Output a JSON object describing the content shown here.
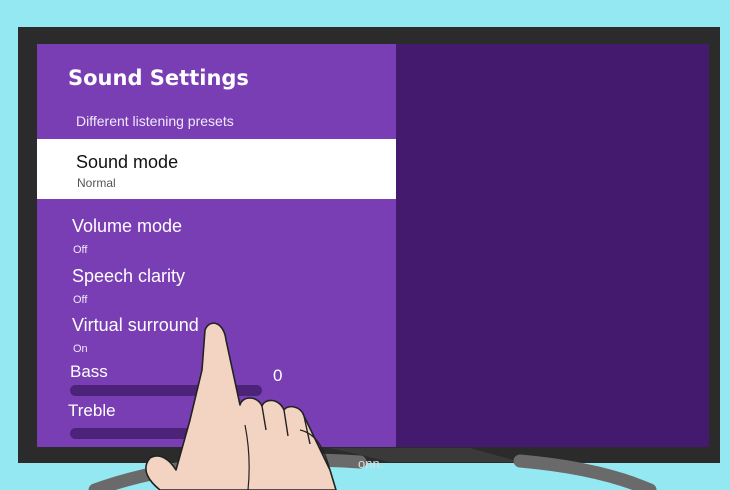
{
  "header": {
    "title": "Sound Settings",
    "subtitle": "Different listening presets"
  },
  "menu": {
    "items": [
      {
        "label": "Sound mode",
        "value": "Normal",
        "selected": true
      },
      {
        "label": "Volume mode",
        "value": "Off"
      },
      {
        "label": "Speech clarity",
        "value": "Off"
      },
      {
        "label": "Virtual surround",
        "value": "On"
      }
    ],
    "sliders": [
      {
        "label": "Bass",
        "value": "0"
      },
      {
        "label": "Treble",
        "value": ""
      }
    ]
  },
  "tv": {
    "brand": "onn."
  },
  "colors": {
    "background": "#94e8f2",
    "panel": "#7a3eb4",
    "screen": "#431a6e",
    "selected_row": "#ffffff",
    "track": "#4c2379"
  }
}
